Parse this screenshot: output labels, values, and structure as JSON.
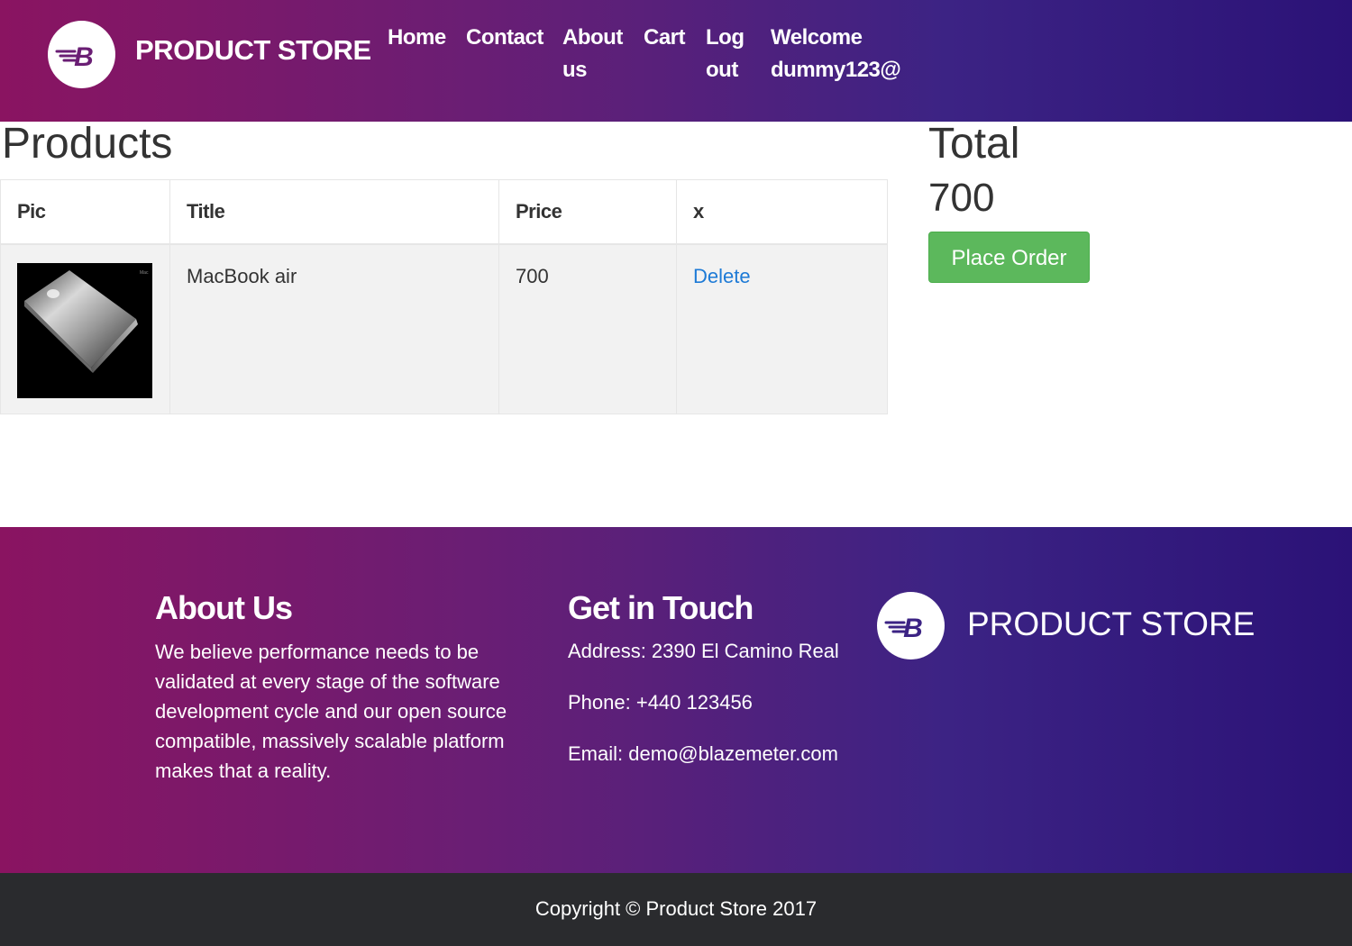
{
  "header": {
    "brand": "PRODUCT STORE",
    "logo_letter": "B",
    "nav": {
      "home": "Home",
      "contact": "Contact",
      "about": "About us",
      "cart": "Cart",
      "logout": "Log out",
      "welcome": "Welcome dummy123@"
    }
  },
  "products": {
    "title": "Products",
    "columns": [
      "Pic",
      "Title",
      "Price",
      "x"
    ],
    "rows": [
      {
        "image": "macbook-air-photo",
        "title": "MacBook air",
        "price": "700",
        "action": "Delete"
      }
    ]
  },
  "total": {
    "label": "Total",
    "value": "700",
    "button": "Place Order"
  },
  "footer": {
    "about_heading": "About Us",
    "about_text": "We believe performance needs to be validated at every stage of the software development cycle and our open source compatible, massively scalable platform makes that a reality.",
    "touch_heading": "Get in Touch",
    "address": "Address: 2390 El Camino Real",
    "phone": "Phone: +440 123456",
    "email": "Email: demo@blazemeter.com",
    "brand": "PRODUCT STORE",
    "logo_letter": "B"
  },
  "copyright": "Copyright © Product Store 2017",
  "colors": {
    "gradient_start": "#8a1461",
    "gradient_end": "#2b1277",
    "button_green": "#5cb85c",
    "link_blue": "#1d7ad6",
    "copyright_bg": "#2a2b2e"
  }
}
